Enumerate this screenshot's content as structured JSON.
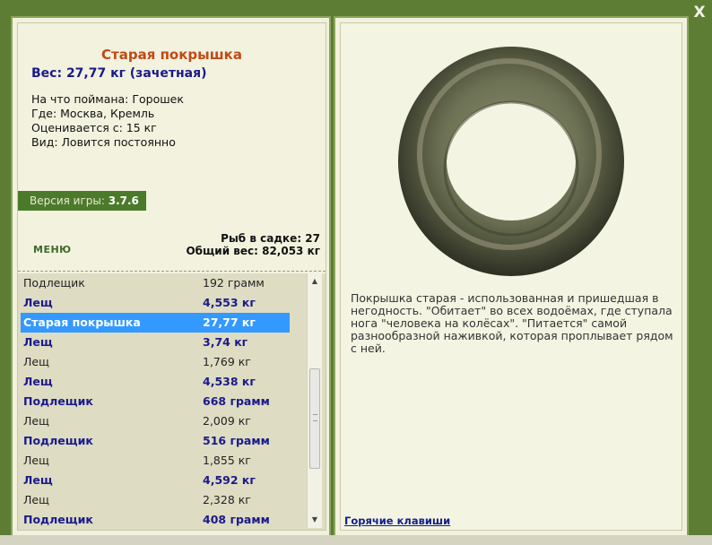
{
  "window": {
    "close_label": "X"
  },
  "item": {
    "title": "Старая покрышка",
    "weight": "Вес: 27,77 кг (зачетная)",
    "caught_on": "На что поймана: Горошек",
    "location": "Где: Москва, Кремль",
    "valued_from": "Оценивается с: 15 кг",
    "kind": "Вид: Ловится постоянно"
  },
  "version": {
    "label": "Версия игры: ",
    "value": "3.7.6"
  },
  "menu_label": "МЕНЮ",
  "stats": {
    "fish_in_cage": "Рыб в садке: 27",
    "total_weight": "Общий вес: 82,053 кг"
  },
  "catch_list": [
    {
      "name": "Подлещик",
      "weight": "192 грамм",
      "style": "plain"
    },
    {
      "name": "Лещ",
      "weight": "4,553 кг",
      "style": "bold"
    },
    {
      "name": "Старая покрышка",
      "weight": "27,77 кг",
      "style": "sel"
    },
    {
      "name": "Лещ",
      "weight": "3,74 кг",
      "style": "bold"
    },
    {
      "name": "Лещ",
      "weight": "1,769 кг",
      "style": "plain"
    },
    {
      "name": "Лещ",
      "weight": "4,538 кг",
      "style": "bold"
    },
    {
      "name": "Подлещик",
      "weight": "668 грамм",
      "style": "bold"
    },
    {
      "name": "Лещ",
      "weight": "2,009 кг",
      "style": "plain"
    },
    {
      "name": "Подлещик",
      "weight": "516 грамм",
      "style": "bold"
    },
    {
      "name": "Лещ",
      "weight": "1,855 кг",
      "style": "plain"
    },
    {
      "name": "Лещ",
      "weight": "4,592 кг",
      "style": "bold"
    },
    {
      "name": "Лещ",
      "weight": "2,328 кг",
      "style": "plain"
    },
    {
      "name": "Подлещик",
      "weight": "408 грамм",
      "style": "bold"
    }
  ],
  "description": "Покрышка старая - использованная и пришедшая в негодность. \"Обитает\" во всех водоёмах, где ступала нога \"человека на колёсах\". \"Питается\" самой разнообразной наживкой, которая проплывает рядом с ней.",
  "hotkeys_label": "Горячие клавиши",
  "icons": {
    "close": "close-icon",
    "scroll_up": "arrow-up-icon",
    "scroll_down": "arrow-down-icon",
    "item_image": "tire-image"
  }
}
